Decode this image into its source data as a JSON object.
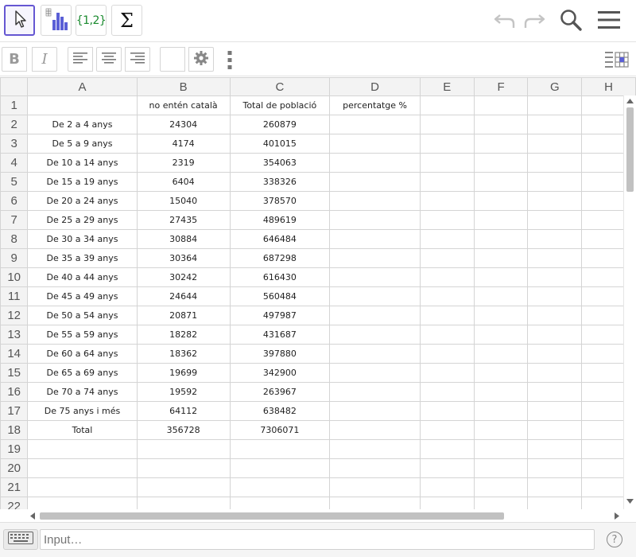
{
  "toolbar": {
    "tools": [
      {
        "name": "move-tool",
        "icon": "arrow-cursor-icon",
        "active": true
      },
      {
        "name": "histogram-tool",
        "icon": "bar-chart-icon",
        "active": false
      },
      {
        "name": "list-tool",
        "label": "{1,2}",
        "active": false
      },
      {
        "name": "sum-tool",
        "label": "Σ",
        "active": false
      }
    ],
    "right_icons": [
      "undo-icon",
      "redo-icon",
      "search-icon",
      "menu-icon"
    ]
  },
  "stylebar": {
    "bold_label": "B",
    "italic_label": "I"
  },
  "columns": [
    "A",
    "B",
    "C",
    "D",
    "E",
    "F",
    "G",
    "H"
  ],
  "rows": [
    {
      "n": "1",
      "cells": [
        "",
        "no entén català",
        "Total de població",
        "percentatge %",
        "",
        "",
        "",
        ""
      ]
    },
    {
      "n": "2",
      "cells": [
        "De 2 a 4 anys",
        "24304",
        "260879",
        "",
        "",
        "",
        "",
        ""
      ]
    },
    {
      "n": "3",
      "cells": [
        "De 5 a 9 anys",
        "4174",
        "401015",
        "",
        "",
        "",
        "",
        ""
      ]
    },
    {
      "n": "4",
      "cells": [
        "De 10 a 14 anys",
        "2319",
        "354063",
        "",
        "",
        "",
        "",
        ""
      ]
    },
    {
      "n": "5",
      "cells": [
        "De 15 a 19 anys",
        "6404",
        "338326",
        "",
        "",
        "",
        "",
        ""
      ]
    },
    {
      "n": "6",
      "cells": [
        "De 20 a 24 anys",
        "15040",
        "378570",
        "",
        "",
        "",
        "",
        ""
      ]
    },
    {
      "n": "7",
      "cells": [
        "De 25 a 29 anys",
        "27435",
        "489619",
        "",
        "",
        "",
        "",
        ""
      ]
    },
    {
      "n": "8",
      "cells": [
        "De 30 a 34 anys",
        "30884",
        "646484",
        "",
        "",
        "",
        "",
        ""
      ]
    },
    {
      "n": "9",
      "cells": [
        "De 35 a 39 anys",
        "30364",
        "687298",
        "",
        "",
        "",
        "",
        ""
      ]
    },
    {
      "n": "10",
      "cells": [
        "De 40 a 44 anys",
        "30242",
        "616430",
        "",
        "",
        "",
        "",
        ""
      ]
    },
    {
      "n": "11",
      "cells": [
        "De 45 a 49 anys",
        "24644",
        "560484",
        "",
        "",
        "",
        "",
        ""
      ]
    },
    {
      "n": "12",
      "cells": [
        "De 50 a 54 anys",
        "20871",
        "497987",
        "",
        "",
        "",
        "",
        ""
      ]
    },
    {
      "n": "13",
      "cells": [
        "De 55 a 59 anys",
        "18282",
        "431687",
        "",
        "",
        "",
        "",
        ""
      ]
    },
    {
      "n": "14",
      "cells": [
        "De 60 a 64 anys",
        "18362",
        "397880",
        "",
        "",
        "",
        "",
        ""
      ]
    },
    {
      "n": "15",
      "cells": [
        "De 65 a 69 anys",
        "19699",
        "342900",
        "",
        "",
        "",
        "",
        ""
      ]
    },
    {
      "n": "16",
      "cells": [
        "De 70 a 74 anys",
        "19592",
        "263967",
        "",
        "",
        "",
        "",
        ""
      ]
    },
    {
      "n": "17",
      "cells": [
        "De 75 anys i més",
        "64112",
        "638482",
        "",
        "",
        "",
        "",
        ""
      ]
    },
    {
      "n": "18",
      "cells": [
        "Total",
        "356728",
        "7306071",
        "",
        "",
        "",
        "",
        ""
      ]
    },
    {
      "n": "19",
      "cells": [
        "",
        "",
        "",
        "",
        "",
        "",
        "",
        ""
      ]
    },
    {
      "n": "20",
      "cells": [
        "",
        "",
        "",
        "",
        "",
        "",
        "",
        ""
      ]
    },
    {
      "n": "21",
      "cells": [
        "",
        "",
        "",
        "",
        "",
        "",
        "",
        ""
      ]
    },
    {
      "n": "22",
      "cells": [
        "",
        "",
        "",
        "",
        "",
        "",
        "",
        ""
      ]
    }
  ],
  "input": {
    "placeholder": "Input…"
  },
  "help_label": "?",
  "colors": {
    "accent": "#6557d2",
    "header_bg": "#f3f3f3",
    "grid_line": "#d4d4d4"
  }
}
